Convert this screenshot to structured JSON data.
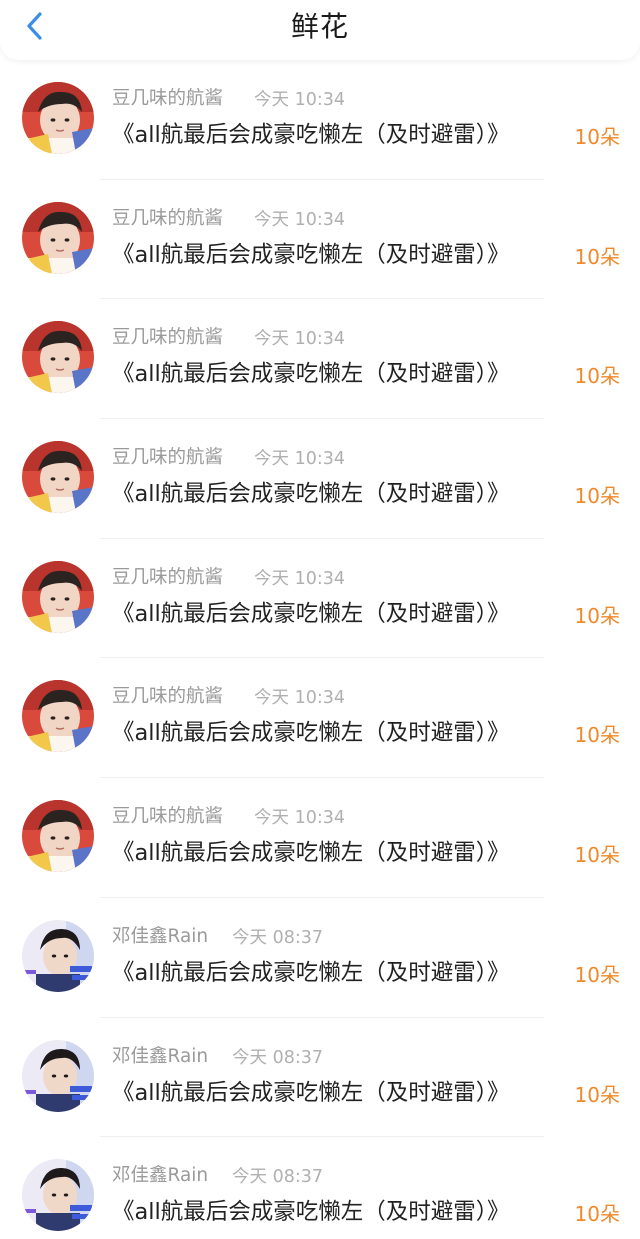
{
  "header": {
    "title": "鲜花",
    "back_icon": "chevron-left-icon",
    "accent_color": "#3a8ee6"
  },
  "colors": {
    "flower_count": "#f0892c",
    "username": "#9a9a9a",
    "time": "#b0b0b0",
    "title": "#222222"
  },
  "records": [
    {
      "user": "豆几味的航酱",
      "time": "今天 10:34",
      "work": "《all航最后会成豪吃懒左（及时避雷）》",
      "count": "10朵",
      "avatar": "avatar-1"
    },
    {
      "user": "豆几味的航酱",
      "time": "今天 10:34",
      "work": "《all航最后会成豪吃懒左（及时避雷）》",
      "count": "10朵",
      "avatar": "avatar-1"
    },
    {
      "user": "豆几味的航酱",
      "time": "今天 10:34",
      "work": "《all航最后会成豪吃懒左（及时避雷）》",
      "count": "10朵",
      "avatar": "avatar-1"
    },
    {
      "user": "豆几味的航酱",
      "time": "今天 10:34",
      "work": "《all航最后会成豪吃懒左（及时避雷）》",
      "count": "10朵",
      "avatar": "avatar-1"
    },
    {
      "user": "豆几味的航酱",
      "time": "今天 10:34",
      "work": "《all航最后会成豪吃懒左（及时避雷）》",
      "count": "10朵",
      "avatar": "avatar-1"
    },
    {
      "user": "豆几味的航酱",
      "time": "今天 10:34",
      "work": "《all航最后会成豪吃懒左（及时避雷）》",
      "count": "10朵",
      "avatar": "avatar-1"
    },
    {
      "user": "豆几味的航酱",
      "time": "今天 10:34",
      "work": "《all航最后会成豪吃懒左（及时避雷）》",
      "count": "10朵",
      "avatar": "avatar-1"
    },
    {
      "user": "邓佳鑫Rain",
      "time": "今天 08:37",
      "work": "《all航最后会成豪吃懒左（及时避雷）》",
      "count": "10朵",
      "avatar": "avatar-2"
    },
    {
      "user": "邓佳鑫Rain",
      "time": "今天 08:37",
      "work": "《all航最后会成豪吃懒左（及时避雷）》",
      "count": "10朵",
      "avatar": "avatar-2"
    },
    {
      "user": "邓佳鑫Rain",
      "time": "今天 08:37",
      "work": "《all航最后会成豪吃懒左（及时避雷）》",
      "count": "10朵",
      "avatar": "avatar-2"
    }
  ]
}
